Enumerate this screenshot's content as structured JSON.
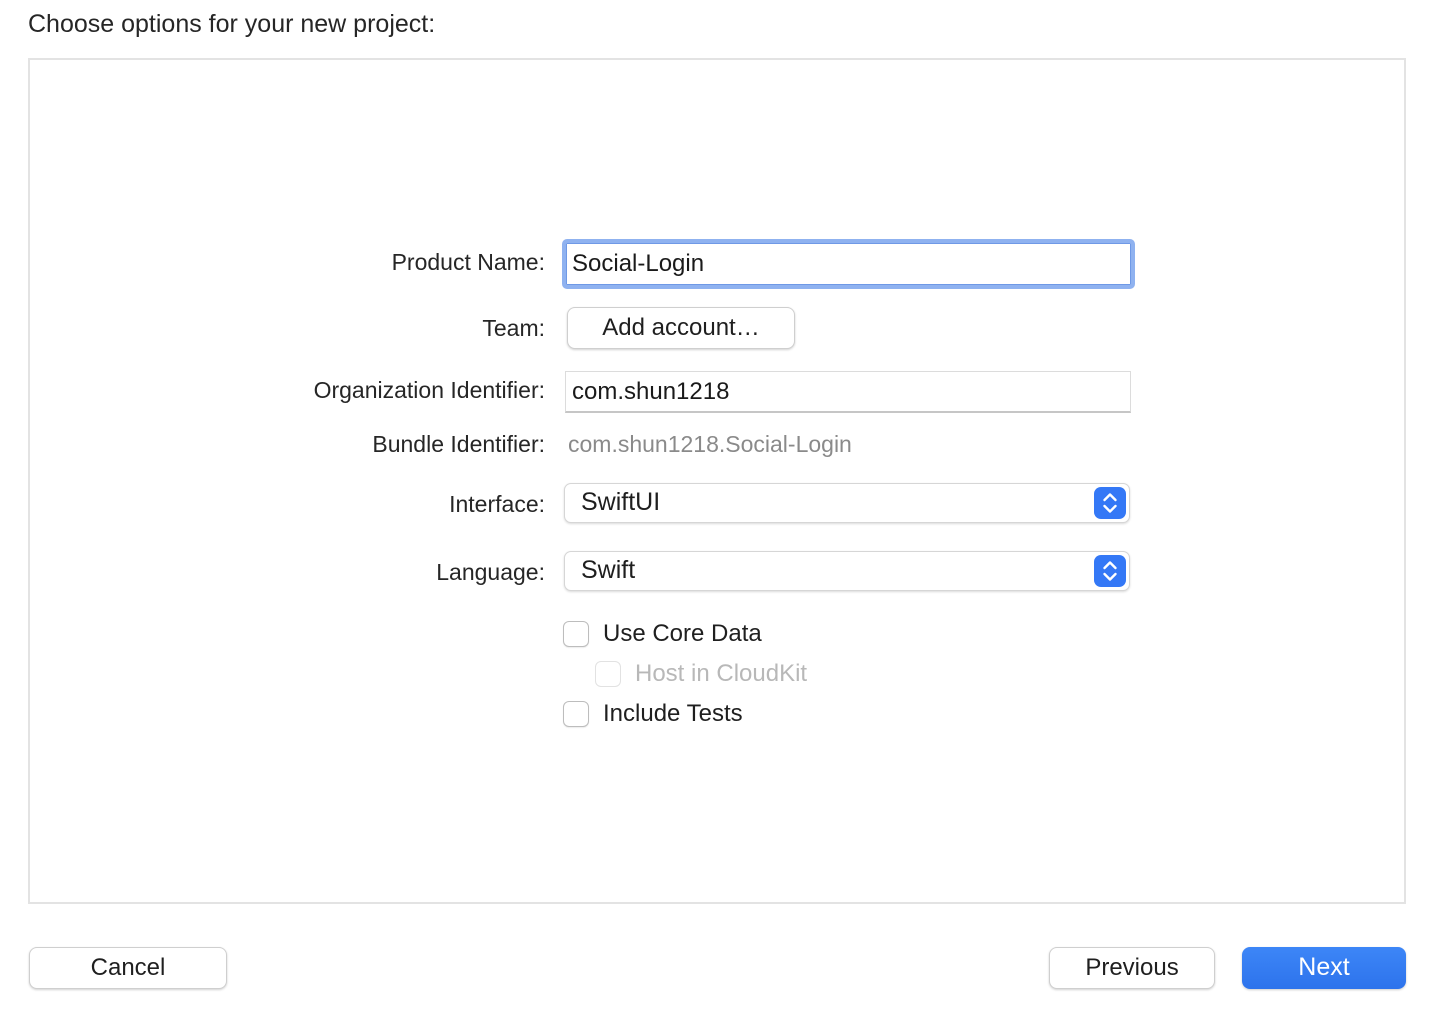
{
  "heading": "Choose options for your new project:",
  "form": {
    "product_name": {
      "label": "Product Name:",
      "value": "Social-Login"
    },
    "team": {
      "label": "Team:",
      "button_label": "Add account…"
    },
    "organization_identifier": {
      "label": "Organization Identifier:",
      "value": "com.shun1218"
    },
    "bundle_identifier": {
      "label": "Bundle Identifier:",
      "value": "com.shun1218.Social-Login"
    },
    "interface": {
      "label": "Interface:",
      "selected": "SwiftUI"
    },
    "language": {
      "label": "Language:",
      "selected": "Swift"
    },
    "options": {
      "use_core_data": {
        "label": "Use Core Data",
        "checked": false,
        "enabled": true
      },
      "host_in_cloudkit": {
        "label": "Host in CloudKit",
        "checked": false,
        "enabled": false
      },
      "include_tests": {
        "label": "Include Tests",
        "checked": false,
        "enabled": true
      }
    }
  },
  "footer": {
    "cancel_label": "Cancel",
    "previous_label": "Previous",
    "next_label": "Next"
  },
  "colors": {
    "accent": "#3478f6",
    "focus_ring": "#8fb2f0",
    "secondary_text": "#8a8a8a",
    "disabled_text": "#b8b8b8"
  },
  "icons": {
    "popup_stepper": "chevron-up-down-icon"
  }
}
